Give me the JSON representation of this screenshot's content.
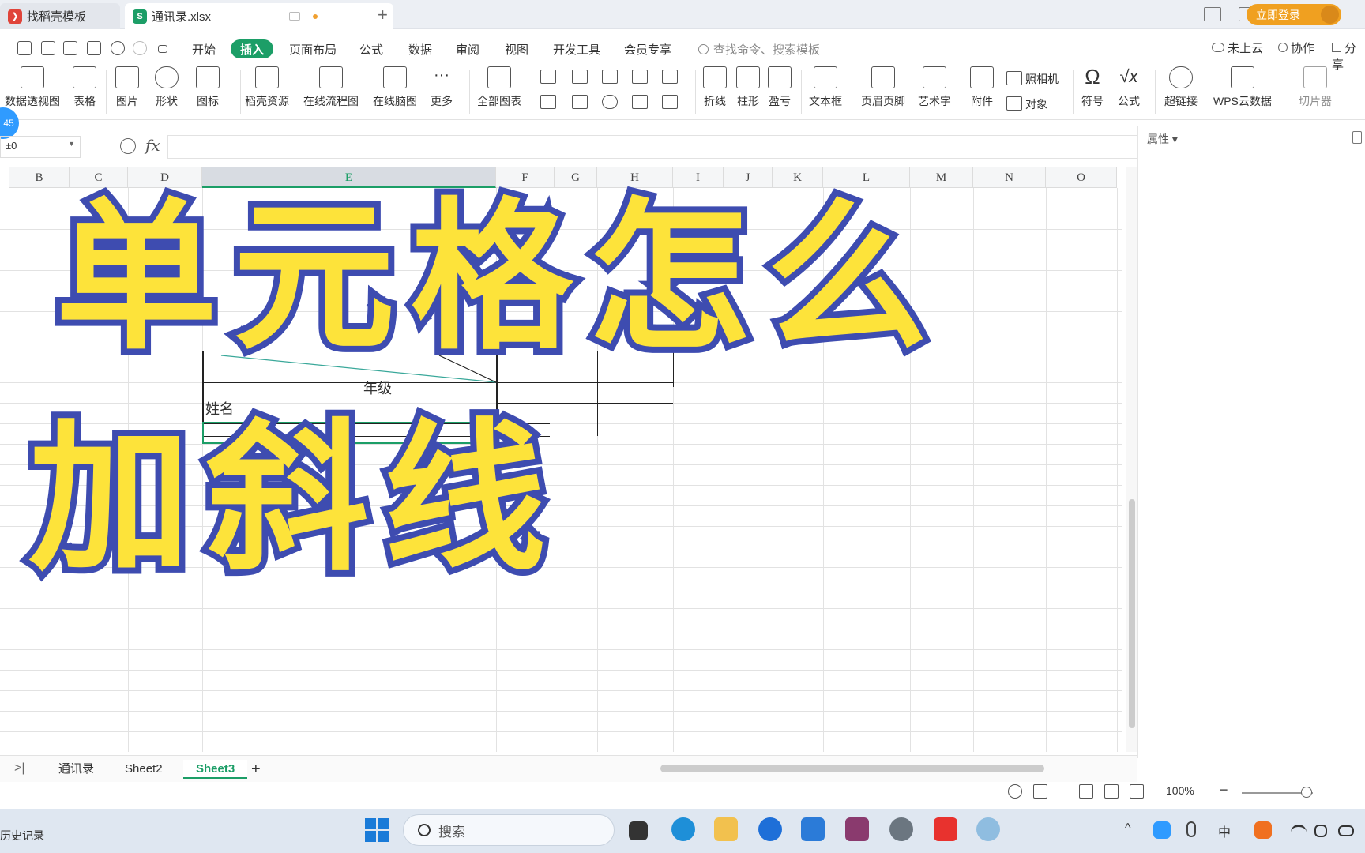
{
  "titlebar": {
    "tabs": [
      {
        "label": "找稻壳模板",
        "icon": "docer-icon",
        "color": "#e0443a"
      },
      {
        "label": "通讯录.xlsx",
        "icon": "spreadsheet-icon",
        "color": "#1c9e67"
      }
    ],
    "login_label": "立即登录"
  },
  "menu": {
    "items": [
      "开始",
      "插入",
      "页面布局",
      "公式",
      "数据",
      "审阅",
      "视图",
      "开发工具",
      "会员专享"
    ],
    "active": "插入",
    "search_placeholder": "查找命令、搜索模板",
    "cloud_label": "未上云",
    "collab_label": "协作",
    "share_label": "分享"
  },
  "ribbon": {
    "buttons": [
      "数据透视图",
      "表格",
      "图片",
      "形状",
      "图标",
      "稻壳资源",
      "在线流程图",
      "在线脑图",
      "更多",
      "全部图表",
      "折线",
      "柱形",
      "盈亏",
      "文本框",
      "页眉页脚",
      "艺术字",
      "附件",
      "符号",
      "公式",
      "超链接",
      "WPS云数据",
      "切片器"
    ],
    "camera_label": "照相机",
    "object_label": "对象"
  },
  "formula_bar": {
    "name_box": "±0",
    "fx_label": "fx",
    "value": ""
  },
  "side_panel": {
    "title": "属性"
  },
  "badge": "45",
  "grid": {
    "columns": [
      "B",
      "C",
      "D",
      "E",
      "F",
      "G",
      "H",
      "I",
      "J",
      "K",
      "L",
      "M",
      "N",
      "O"
    ],
    "selected_column": "E",
    "cell_name": "姓名",
    "cell_grade": "年级"
  },
  "sheets": {
    "tabs": [
      "通讯录",
      "Sheet2",
      "Sheet3"
    ],
    "active": "Sheet3",
    "add_label": "+"
  },
  "status": {
    "zoom": "100%",
    "zoom_level": 0.83
  },
  "taskbar": {
    "history_label": "历史记录",
    "search_placeholder": "搜索",
    "ime_label": "中"
  },
  "overlay": {
    "line1": "单元格怎么",
    "line2": "加斜线",
    "fill_color": "#fde33a",
    "stroke_color": "#3e4cb0"
  },
  "colors": {
    "accent": "#1c9e67",
    "login": "#f0a020"
  }
}
